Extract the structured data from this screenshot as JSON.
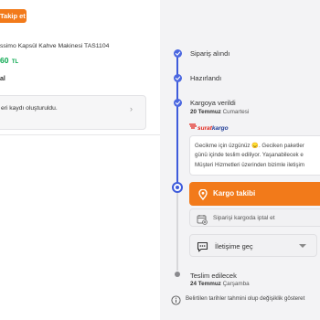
{
  "left": {
    "track_button": "Takip et",
    "product_name": "ssimo Kapsül Kahve Makinesi TAS1104",
    "price_value": "60",
    "price_currency": "TL",
    "small_label": "al",
    "notice_text": "eri kaydı oluşturuldu.",
    "notice_chevron": "›"
  },
  "timeline": {
    "step1": "Sipariş alındı",
    "step2": "Hazırlandı",
    "step3": "Kargoya verildi",
    "step3_date": "20 Temmuz",
    "step3_day": "Cumartesi",
    "carrier_part1": "surat",
    "carrier_part2": "kargo",
    "message_lines": [
      "Gecikme için üzgünüz 😞. Geciken paketler",
      "günü içinde teslim ediliyor. Yaşanabilecek e",
      "Müşteri Hizmetleri üzerinden bizimle iletişim"
    ],
    "track_cargo_button": "Kargo takibi",
    "cancel_text": "Siparişi kargoda iptal et",
    "contact_button": "İletişime geç",
    "delivery_title": "Teslim edilecek",
    "delivery_date": "24 Temmuz",
    "delivery_day": "Çarşamba",
    "info_note": "Belirtilen tarihler tahmini olup değişiklik gösteret"
  },
  "colors": {
    "accent": "#f27a1a",
    "timeline_blue": "#3e5bdb",
    "price_green": "#0aa84f"
  },
  "icons": {
    "check": "check-icon",
    "location": "location-pin-icon",
    "cancel": "calendar-cancel-icon",
    "chat": "chat-icon",
    "info": "info-icon"
  }
}
